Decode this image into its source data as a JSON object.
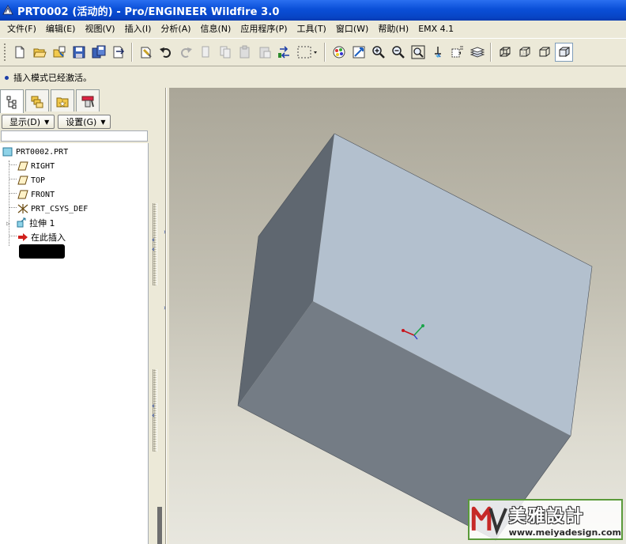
{
  "window": {
    "title": "PRT0002 (活动的) - Pro/ENGINEER Wildfire 3.0"
  },
  "menu": {
    "items": [
      "文件(F)",
      "编辑(E)",
      "视图(V)",
      "插入(I)",
      "分析(A)",
      "信息(N)",
      "应用程序(P)",
      "工具(T)",
      "窗口(W)",
      "帮助(H)",
      "EMX 4.1"
    ]
  },
  "toolbar": {
    "buttons": [
      "new-icon",
      "open-icon",
      "open-folder-icon",
      "save-icon",
      "save-copy-icon",
      "backup-icon",
      "regenerate-icon",
      "undo-icon",
      "redo-icon",
      "cut-icon",
      "copy-icon",
      "paste-icon",
      "paste-special-icon",
      "repaint-icon",
      "selection-box-icon",
      "appearance-icon",
      "orient-icon",
      "zoom-in-icon",
      "zoom-out-icon",
      "refit-icon",
      "spin-center-icon",
      "view-manager-icon",
      "layers-icon",
      "wireframe-icon",
      "hidden-line-icon",
      "no-hidden-icon",
      "shading-icon"
    ]
  },
  "message": {
    "text": "插入模式已经激活。"
  },
  "navigator": {
    "tabs": [
      "model-tree-icon",
      "folder-browser-icon",
      "favorites-icon",
      "connections-icon"
    ],
    "show_label": "显示(D)",
    "settings_label": "设置(G)",
    "tree": [
      {
        "label": "PRT0002.PRT",
        "icon": "part-icon"
      },
      {
        "label": "RIGHT",
        "icon": "datum-plane-icon"
      },
      {
        "label": "TOP",
        "icon": "datum-plane-icon"
      },
      {
        "label": "FRONT",
        "icon": "datum-plane-icon"
      },
      {
        "label": "PRT_CSYS_DEF",
        "icon": "csys-icon"
      },
      {
        "label": "拉伸 1",
        "icon": "extrude-icon"
      },
      {
        "label": "在此插入",
        "icon": "insert-arrow-icon"
      }
    ]
  },
  "colors": {
    "titlebar": "#0a4fd8",
    "model_top": "#b3c0ce",
    "model_side": "#5f6770",
    "model_front": "#747c85",
    "insert_arrow": "#d0201c"
  },
  "watermark": {
    "cn": "美雅設計",
    "url": "www.meiyadesign.com"
  }
}
